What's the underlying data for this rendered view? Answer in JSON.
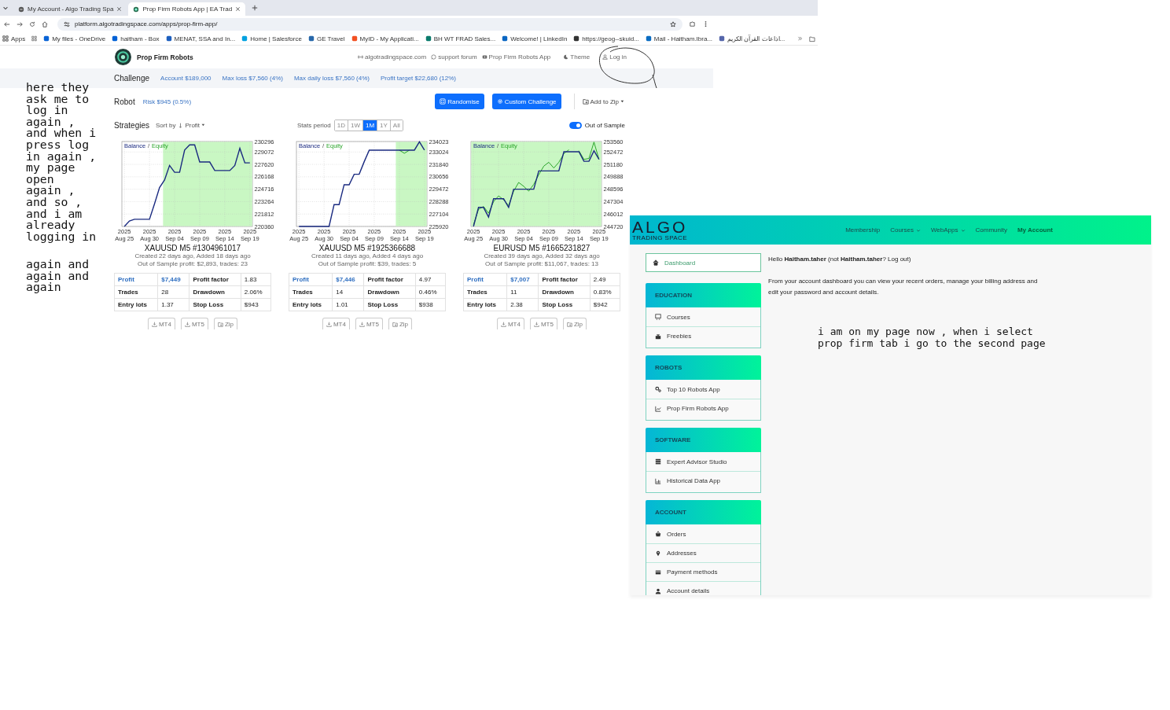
{
  "browser": {
    "tabs": [
      {
        "title": "My Account - Algo Trading Spa",
        "selected": false
      },
      {
        "title": "Prop Firm Robots App | EA Trad",
        "selected": true
      }
    ],
    "url": "platform.algotradingspace.com/apps/prop-firm-app/",
    "bookmarks": [
      "Apps",
      "My files - OneDrive",
      "haitham - Box",
      "MENAT, SSA and In...",
      "Home | Salesforce",
      "GE Travel",
      "MyID - My Applicati...",
      "BH WT FRAD Sales...",
      "Welcome! | LinkedIn",
      "https://geog--skuid...",
      "Mail - Haitham.Ibra...",
      "اذاعات القرآن الكريم..."
    ]
  },
  "app": {
    "brand": "Prop Firm Robots",
    "links": [
      "algotradingspace.com",
      "support forum",
      "Prop Firm Robots App",
      "Theme",
      "Log in"
    ],
    "challenge": {
      "label": "Challenge",
      "items": [
        "Account $189,000",
        "Max loss $7,560 (4%)",
        "Max daily loss $7,560 (4%)",
        "Profit target $22,680 (12%)"
      ]
    },
    "robot": {
      "label": "Robot",
      "risk": "Risk $945 (0.5%)",
      "buttons": [
        "Randomise",
        "Custom Challenge"
      ],
      "add_to_zip": "Add to Zip"
    },
    "strategies": {
      "label": "Strategies",
      "sort_by": "Sort by",
      "sort_field": "Profit",
      "stats_label": "Stats period",
      "periods": [
        {
          "label": "1D",
          "selected": false
        },
        {
          "label": "1W",
          "selected": false
        },
        {
          "label": "1M",
          "selected": true
        },
        {
          "label": "1Y",
          "selected": false
        },
        {
          "label": "All",
          "selected": false
        }
      ],
      "out_of_sample": {
        "label": "Out of Sample",
        "on": true
      }
    },
    "cards": [
      {
        "title": "XAUUSD M5 #1304961017",
        "created": "Created 22 days ago, Added 18 days ago",
        "oos": "Out of Sample profit: $2,893, trades: 23",
        "legend_separator": "/",
        "chart_data": {
          "type": "line",
          "categories": [
            "2025 Aug 25",
            null,
            null,
            null,
            null,
            "2025 Aug 30",
            null,
            null,
            null,
            null,
            "2025 Sep 04",
            null,
            null,
            null,
            null,
            "2025 Sep 09",
            null,
            null,
            null,
            null,
            "2025 Sep 14",
            null,
            null,
            null,
            null,
            "2025 Sep 19"
          ],
          "series": [
            {
              "name": "Balance",
              "color": "#1a2a80",
              "values": [
                220360,
                221000,
                221200,
                221200,
                221200,
                221200,
                223000,
                224900,
                225800,
                227500,
                226700,
                226700,
                229300,
                229900,
                229900,
                227900,
                227900,
                227900,
                226900,
                226900,
                226900,
                226900,
                227500,
                229500,
                227800,
                227800
              ]
            },
            {
              "name": "Equity",
              "color": "#2aa52a",
              "values": [
                null,
                null,
                null,
                null,
                null,
                null,
                null,
                null,
                null,
                null,
                null,
                null,
                null,
                null,
                null,
                null,
                null,
                null,
                null,
                null,
                null,
                null,
                null,
                null,
                null,
                null
              ]
            }
          ],
          "ylim": [
            220360,
            230296
          ],
          "yticks": [
            220360,
            221812,
            223264,
            224716,
            226168,
            227620,
            229072,
            230296
          ],
          "grid": true
        },
        "stats": [
          [
            "Profit",
            "$7,449",
            "Profit factor",
            "1.83"
          ],
          [
            "Trades",
            "28",
            "Drawdown",
            "2.06%"
          ],
          [
            "Entry lots",
            "1.37",
            "Stop Loss",
            "$943"
          ]
        ],
        "downloads": [
          "MT4",
          "MT5",
          "Zip"
        ]
      },
      {
        "title": "XAUUSD M5 #1925366688",
        "created": "Created 11 days ago, Added 4 days ago",
        "oos": "Out of Sample profit: $39, trades: 5",
        "legend_separator": "/",
        "chart_data": {
          "type": "line",
          "categories": [
            "2025 Aug 25",
            null,
            null,
            null,
            null,
            "2025 Aug 30",
            null,
            null,
            null,
            null,
            "2025 Sep 04",
            null,
            null,
            null,
            null,
            "2025 Sep 09",
            null,
            null,
            null,
            null,
            "2025 Sep 14",
            null,
            null,
            null,
            null,
            "2025 Sep 19"
          ],
          "series": [
            {
              "name": "Balance",
              "color": "#1a2a80",
              "values": [
                225920,
                225920,
                225920,
                225920,
                225920,
                225920,
                225920,
                228000,
                228000,
                229900,
                229900,
                230900,
                230900,
                232100,
                233200,
                233200,
                233200,
                233200,
                233200,
                233200,
                233200,
                233200,
                233200,
                233200,
                234000,
                233200
              ]
            },
            {
              "name": "Equity",
              "color": "#2aa52a",
              "values": [
                null,
                null,
                null,
                null,
                null,
                null,
                null,
                null,
                null,
                null,
                null,
                null,
                null,
                null,
                null,
                null,
                null,
                null,
                null,
                null,
                233200,
                232900,
                233200,
                null,
                null,
                null
              ]
            }
          ],
          "ylim": [
            225920,
            234023
          ],
          "yticks": [
            225920,
            227104,
            228288,
            229472,
            230656,
            231840,
            233024,
            234023
          ],
          "grid": true
        },
        "stats": [
          [
            "Profit",
            "$7,446",
            "Profit factor",
            "4.97"
          ],
          [
            "Trades",
            "14",
            "Drawdown",
            "0.46%"
          ],
          [
            "Entry lots",
            "1.01",
            "Stop Loss",
            "$938"
          ]
        ],
        "downloads": [
          "MT4",
          "MT5",
          "Zip"
        ]
      },
      {
        "title": "EURUSD M5 #1665231827",
        "created": "Created 39 days ago, Added 32 days ago",
        "oos": "Out of Sample profit: $11,067, trades: 13",
        "legend_separator": "/",
        "chart_data": {
          "type": "line",
          "categories": [
            "2025 Aug 25",
            null,
            null,
            null,
            null,
            "2025 Aug 30",
            null,
            null,
            null,
            null,
            "2025 Sep 04",
            null,
            null,
            null,
            null,
            "2025 Sep 09",
            null,
            null,
            null,
            null,
            "2025 Sep 14",
            null,
            null,
            null,
            null,
            "2025 Sep 19"
          ],
          "series": [
            {
              "name": "Balance",
              "color": "#1a2a80",
              "values": [
                244720,
                246700,
                246700,
                245700,
                247600,
                247600,
                247600,
                246700,
                248600,
                248600,
                248600,
                248600,
                248600,
                250500,
                250500,
                250500,
                250500,
                250500,
                252500,
                252500,
                252500,
                252500,
                251500,
                251500,
                252600,
                251700
              ]
            },
            {
              "name": "Equity",
              "color": "#2aa52a",
              "values": [
                244900,
                246500,
                246800,
                246100,
                247300,
                247900,
                247500,
                246900,
                248400,
                249300,
                248900,
                248400,
                249100,
                250100,
                251000,
                251400,
                250800,
                251400,
                252300,
                252700,
                null,
                252600,
                251700,
                251800,
                253500,
                251700
              ]
            }
          ],
          "ylim": [
            244720,
            253560
          ],
          "yticks": [
            244720,
            246012,
            247304,
            248596,
            249888,
            251180,
            252472,
            253560
          ],
          "grid": true
        },
        "stats": [
          [
            "Profit",
            "$7,007",
            "Profit factor",
            "2.49"
          ],
          [
            "Trades",
            "11",
            "Drawdown",
            "0.83%"
          ],
          [
            "Entry lots",
            "2.38",
            "Stop Loss",
            "$942"
          ]
        ],
        "downloads": [
          "MT4",
          "MT5",
          "Zip"
        ]
      }
    ]
  },
  "account": {
    "logo": {
      "word": "ALGO",
      "tagline": "TRADING SPACE"
    },
    "nav": [
      {
        "label": "Membership",
        "dropdown": false,
        "selected": false
      },
      {
        "label": "Courses",
        "dropdown": true,
        "selected": false
      },
      {
        "label": "WebApps",
        "dropdown": true,
        "selected": false
      },
      {
        "label": "Community",
        "dropdown": false,
        "selected": false
      },
      {
        "label": "My Account",
        "dropdown": false,
        "selected": true
      }
    ],
    "dashboard": {
      "label": "Dashboard",
      "selected": true
    },
    "sections": [
      {
        "title": "EDUCATION",
        "items": [
          "Courses",
          "Freebies"
        ]
      },
      {
        "title": "ROBOTS",
        "items": [
          "Top 10 Robots App",
          "Prop Firm Robots App"
        ]
      },
      {
        "title": "SOFTWARE",
        "items": [
          "Expert Advisor Studio",
          "Historical Data App"
        ]
      },
      {
        "title": "ACCOUNT",
        "items": [
          "Orders",
          "Addresses",
          "Payment methods",
          "Account details"
        ]
      }
    ],
    "greeting": {
      "text": "Hello **Haitham.taher** (not **Haitham.taher**?",
      "link": "Log out",
      "close": ")"
    },
    "intro": "From your account dashboard you can view your recent orders, manage your billing address and edit your password and account details."
  },
  "notes": [
    "here they\nask me to\nlog in\nagain ,\nand when i\npress log\nin again ,\nmy page\nopen\nagain ,\nand so ,\nand i am\nalready\nlogging in",
    "again and\nagain and\nagain",
    "i am on my page now , when i select\nprop firm tab i go to the second page"
  ]
}
